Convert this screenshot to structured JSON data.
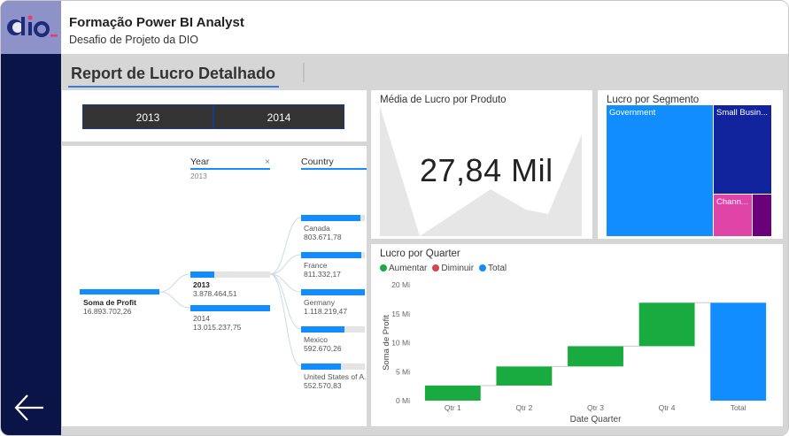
{
  "app": {
    "title": "Formação Power BI Analyst",
    "subtitle": "Desafio de Projeto da DIO",
    "logo_text": "dio"
  },
  "report": {
    "title": "Report de Lucro Detalhado"
  },
  "slicer": {
    "options": [
      "2013",
      "2014"
    ]
  },
  "card": {
    "title": "Média de Lucro por Produto",
    "value": "27,84 Mil"
  },
  "treemap": {
    "title": "Lucro por Segmento",
    "items": [
      {
        "label": "Government",
        "color": "#118dff"
      },
      {
        "label": "Small Busin...",
        "color": "#12239e"
      },
      {
        "label": "Chann...",
        "color": "#e044a7"
      },
      {
        "label": "",
        "color": "#6b007b"
      }
    ]
  },
  "decomp_tree": {
    "root": {
      "label": "Soma de Profit",
      "value": "16.893.702,26"
    },
    "year_header": "Year",
    "year_filter": "2013",
    "country_header": "Country",
    "years": [
      {
        "label": "2013",
        "value": "3.878.464,51",
        "fill": 0.3
      },
      {
        "label": "2014",
        "value": "13.015.237,75",
        "fill": 1.0
      }
    ],
    "countries": [
      {
        "label": "Canada",
        "value": "803.671,78",
        "fill": 0.93
      },
      {
        "label": "France",
        "value": "811.332,17",
        "fill": 0.94
      },
      {
        "label": "Germany",
        "value": "1.118.219,47",
        "fill": 1.0
      },
      {
        "label": "Mexico",
        "value": "592.670,26",
        "fill": 0.68
      },
      {
        "label": "United States of A...",
        "value": "552.570,83",
        "fill": 0.63
      }
    ]
  },
  "waterfall": {
    "title": "Lucro por Quarter",
    "legend": [
      {
        "label": "Aumentar",
        "color": "#1aab40"
      },
      {
        "label": "Diminuir",
        "color": "#d64554"
      },
      {
        "label": "Total",
        "color": "#118dff"
      }
    ],
    "xlabel": "Date Quarter",
    "ylabel": "Soma de Profit",
    "yticks": [
      "0 Mi",
      "5 Mi",
      "10 Mi",
      "15 Mi",
      "20 Mi"
    ]
  },
  "chart_data": {
    "type": "bar",
    "subtype": "waterfall",
    "title": "Lucro por Quarter",
    "xlabel": "Date Quarter",
    "ylabel": "Soma de Profit",
    "categories": [
      "Qtr 1",
      "Qtr 2",
      "Qtr 3",
      "Qtr 4",
      "Total"
    ],
    "values": [
      2.6,
      3.3,
      3.5,
      7.5,
      16.9
    ],
    "kinds": [
      "increase",
      "increase",
      "increase",
      "increase",
      "total"
    ],
    "ylim": [
      0,
      20
    ],
    "grid": false,
    "legend_position": "top-left"
  }
}
